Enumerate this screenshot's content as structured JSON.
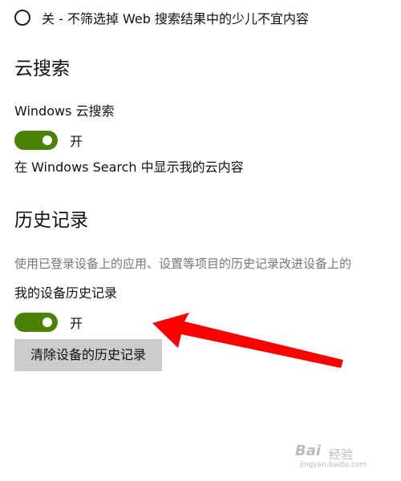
{
  "safe_search": {
    "off_option_label": "关 - 不筛选掉 Web 搜索结果中的少儿不宜内容"
  },
  "cloud_search": {
    "heading": "云搜索",
    "setting_label": "Windows 云搜索",
    "toggle_state": "开",
    "description": "在 Windows Search 中显示我的云内容"
  },
  "history": {
    "heading": "历史记录",
    "description": "使用已登录设备上的应用、设置等项目的历史记录改进设备上的",
    "device_history_label": "我的设备历史记录",
    "toggle_state": "开",
    "clear_button_label": "清除设备的历史记录"
  },
  "colors": {
    "toggle_on": "#498205",
    "button_bg": "#cccccc",
    "arrow": "#ff0000"
  },
  "watermark": {
    "brand": "Bai",
    "sub": "经验",
    "url": "jingyan.baidu.com"
  }
}
